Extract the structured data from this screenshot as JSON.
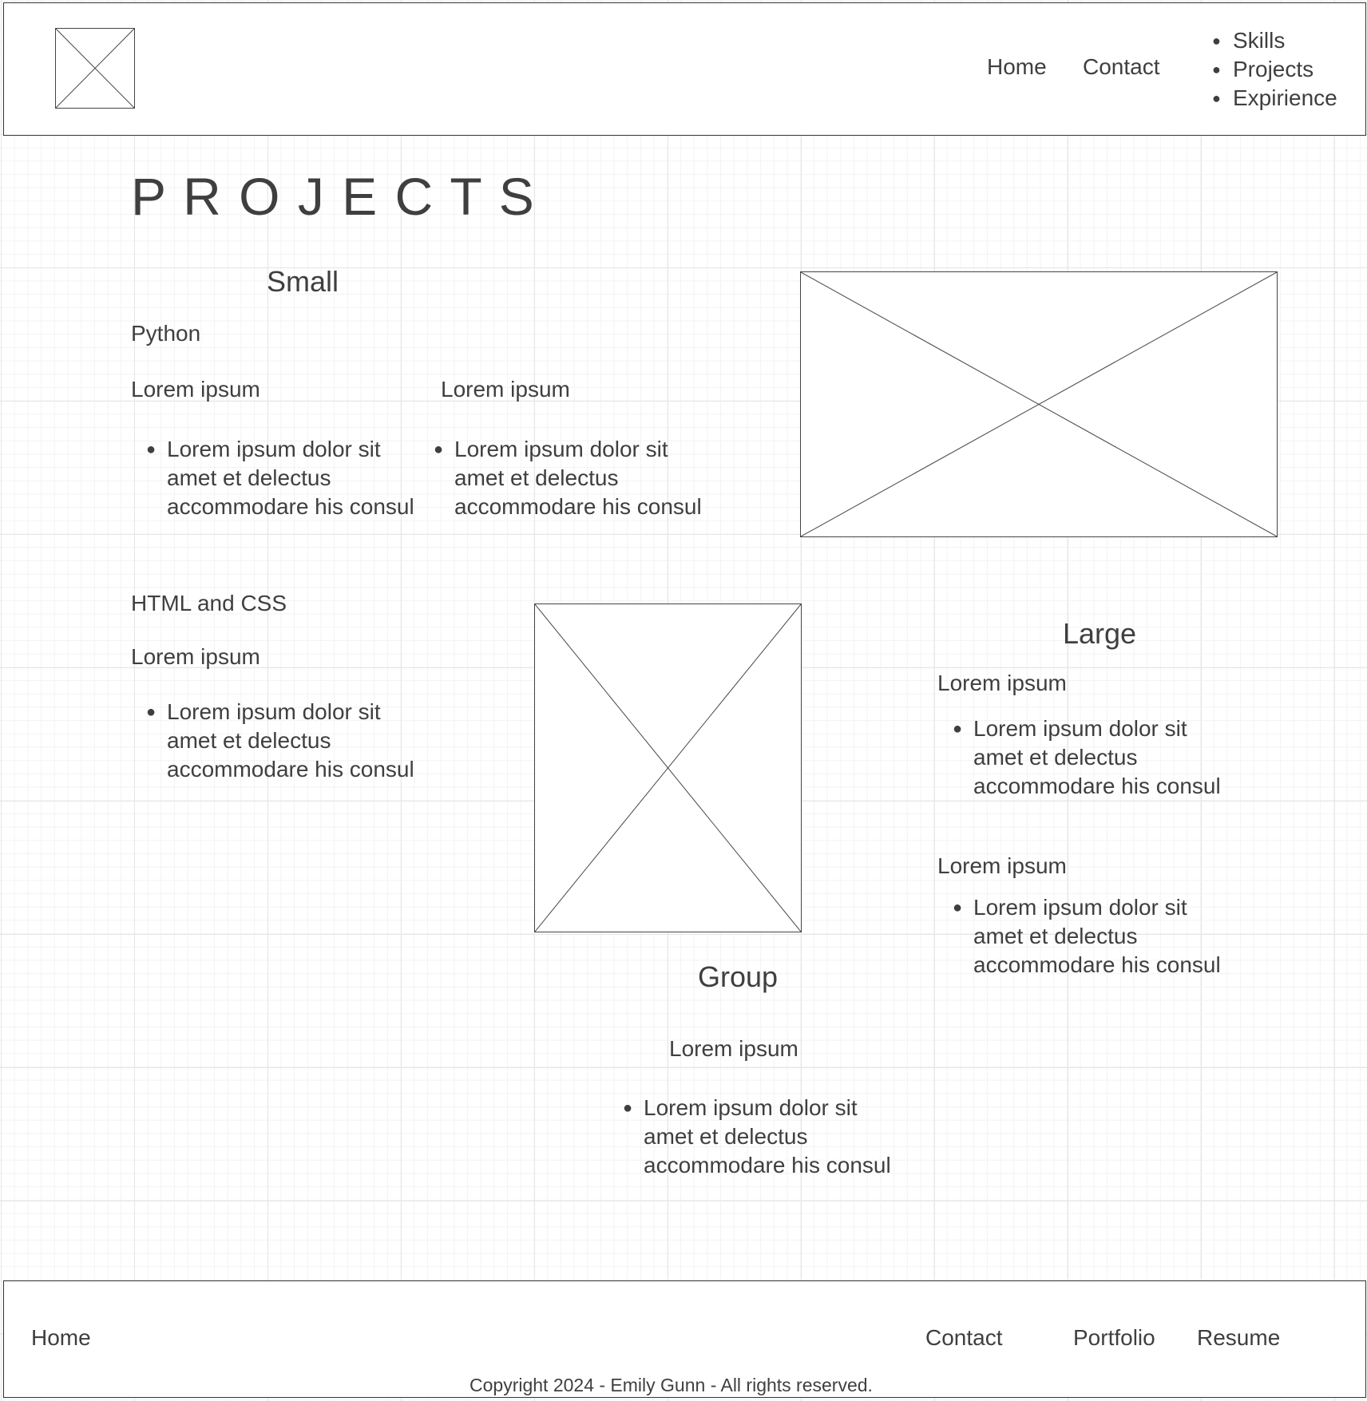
{
  "header": {
    "nav": {
      "home": "Home",
      "contact": "Contact"
    },
    "menu": [
      "Skills",
      "Projects",
      "Expirience"
    ]
  },
  "page_title": "P R O J E C T S",
  "small": {
    "heading": "Small",
    "python_label": "Python",
    "col1_title": "Lorem ipsum",
    "col1_bullet": "Lorem ipsum dolor sit amet et delectus accommodare his consul",
    "col2_title": "Lorem ipsum",
    "col2_bullet": "Lorem ipsum dolor sit amet et delectus accommodare his consul",
    "html_label": "HTML and CSS",
    "col3_title": "Lorem ipsum",
    "col3_bullet": "Lorem ipsum dolor sit amet et delectus accommodare his consul"
  },
  "large": {
    "heading": "Large",
    "item1_title": "Lorem ipsum",
    "item1_bullet": "Lorem ipsum dolor sit amet et delectus accommodare his consul",
    "item2_title": "Lorem ipsum",
    "item2_bullet": "Lorem ipsum dolor sit amet et delectus accommodare his consul"
  },
  "group": {
    "heading": "Group",
    "title": "Lorem ipsum",
    "bullet": "Lorem ipsum dolor sit amet et delectus accommodare his consul"
  },
  "bullet_glyph": "●",
  "footer": {
    "home": "Home",
    "contact": "Contact",
    "portfolio": "Portfolio",
    "resume": "Resume",
    "copyright": "Copyright 2024 - Emily Gunn - All rights reserved."
  }
}
